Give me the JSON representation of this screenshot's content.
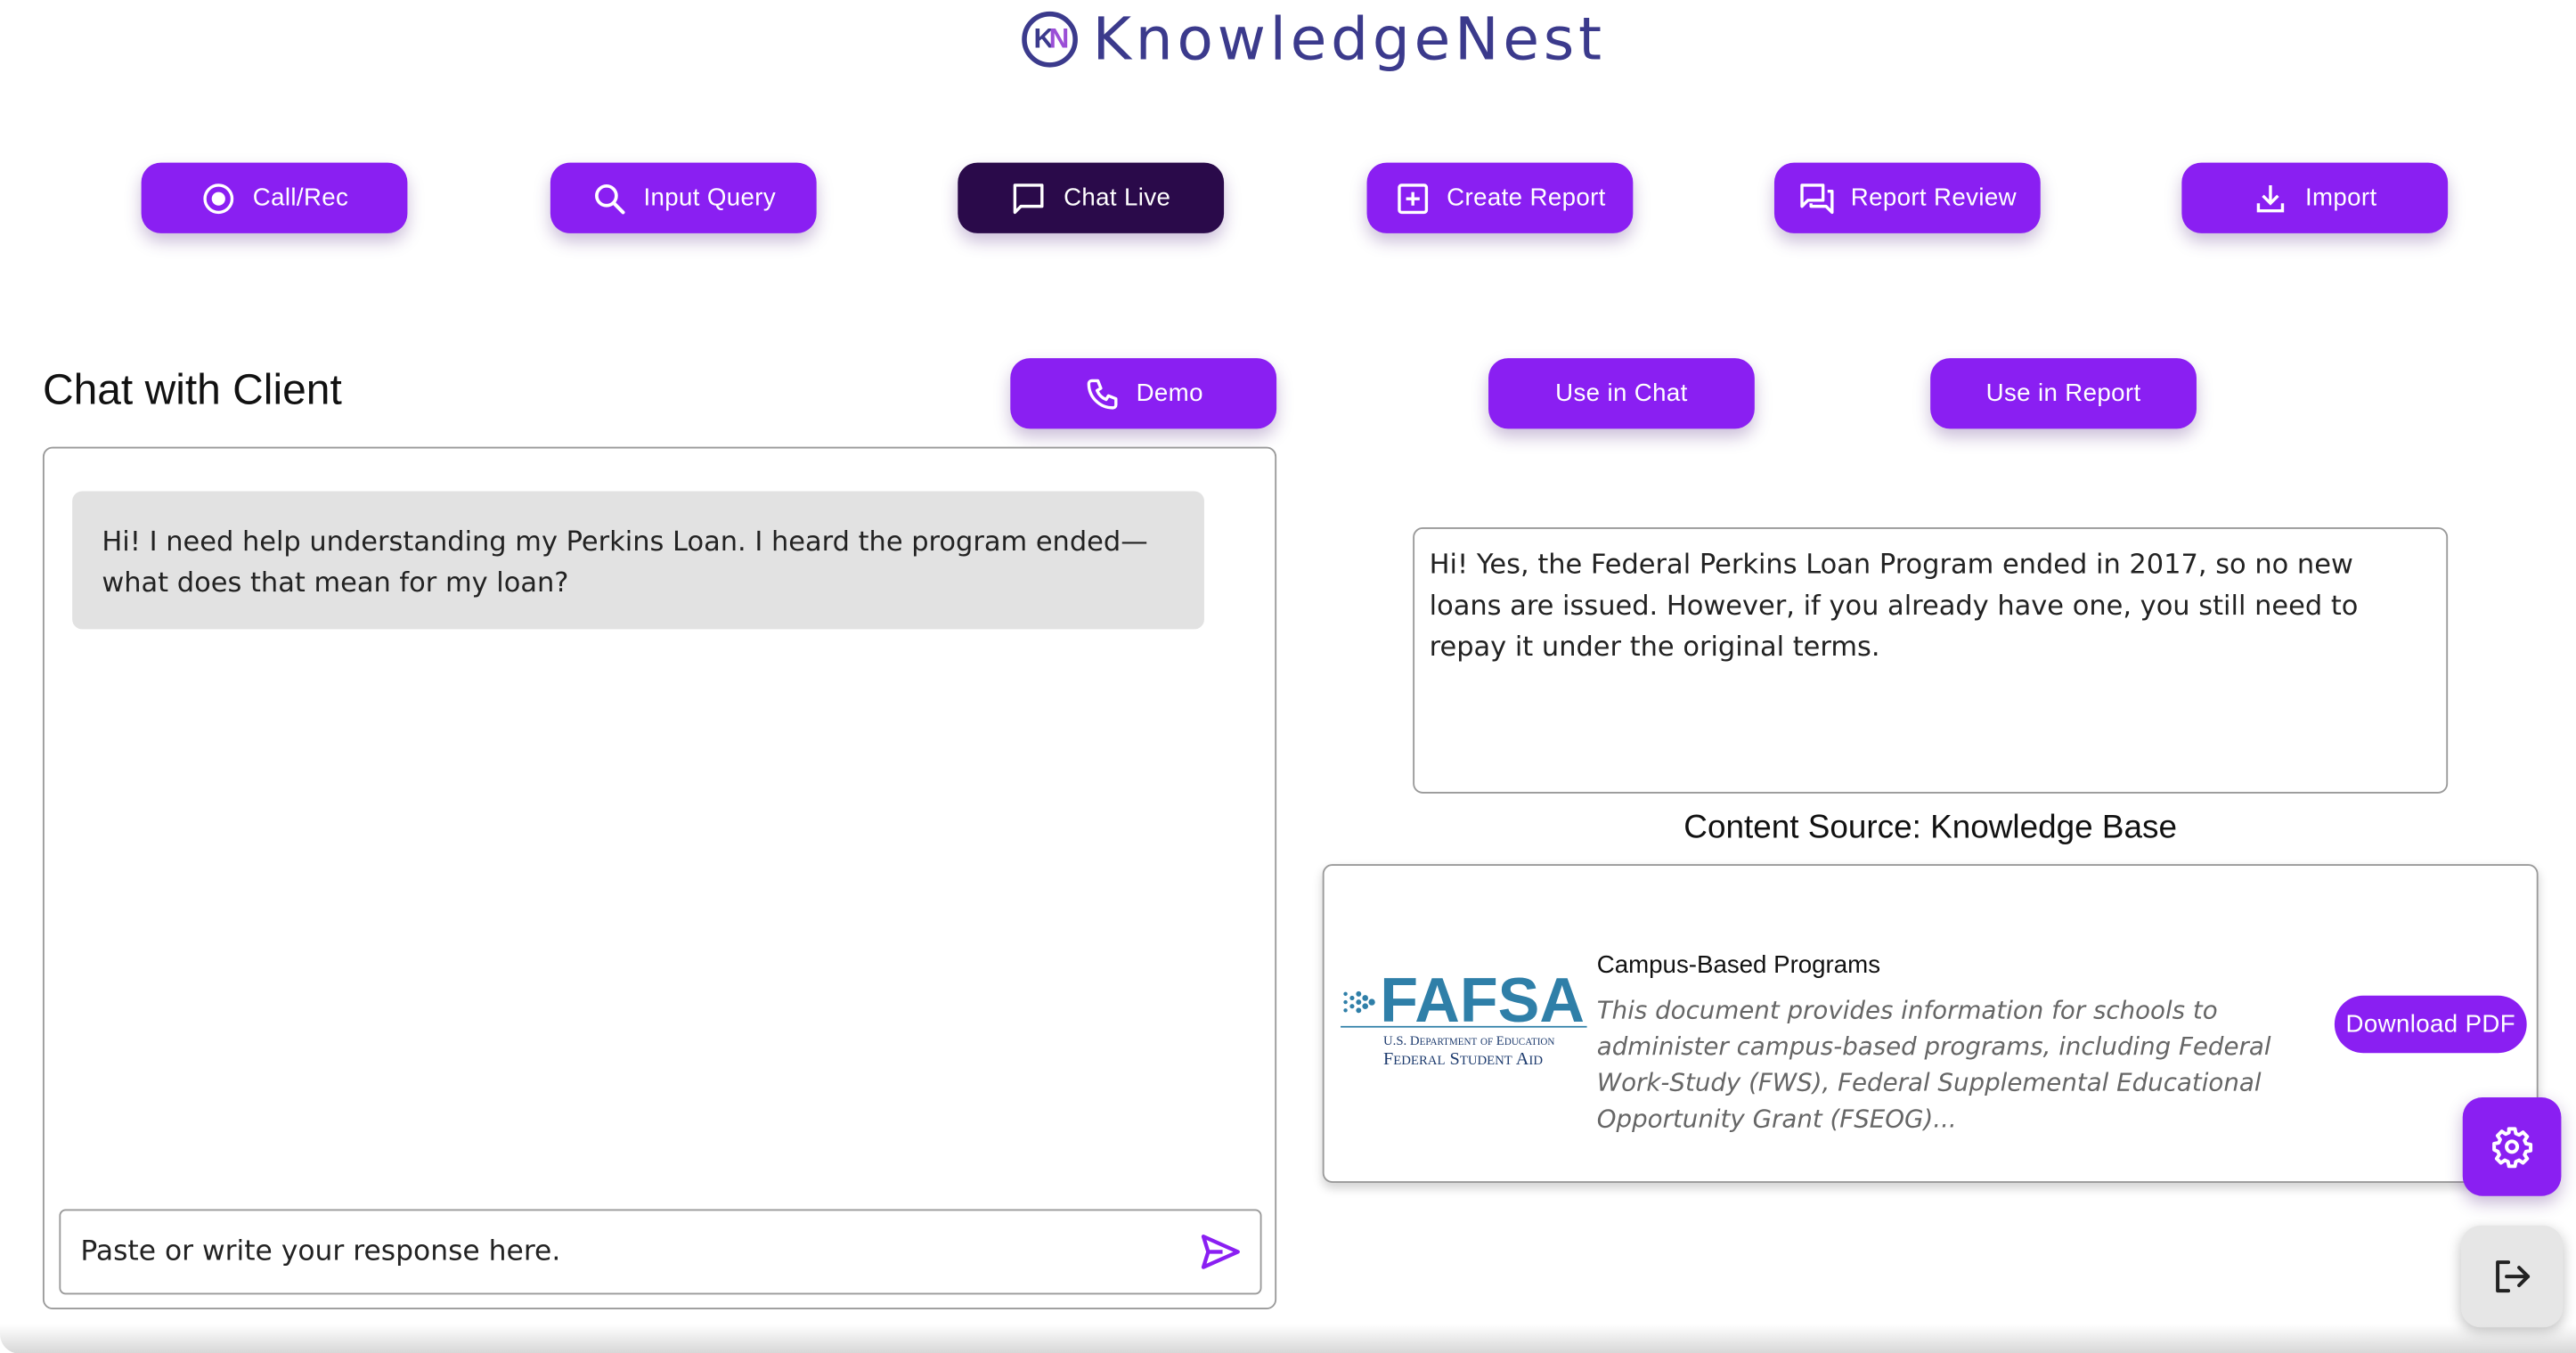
{
  "app": {
    "name": "KnowledgeNest",
    "logo_initials_k": "K",
    "logo_initials_n": "N"
  },
  "nav": {
    "buttons": [
      {
        "label": "Call/Rec",
        "icon": "record-icon",
        "active": false
      },
      {
        "label": "Input Query",
        "icon": "search-icon",
        "active": false
      },
      {
        "label": "Chat Live",
        "icon": "chat-bubble-icon",
        "active": true
      },
      {
        "label": "Create Report",
        "icon": "plus-box-icon",
        "active": false
      },
      {
        "label": "Report Review",
        "icon": "forum-icon",
        "active": false
      },
      {
        "label": "Import",
        "icon": "download-icon",
        "active": false
      }
    ]
  },
  "chat": {
    "title": "Chat with Client",
    "demo_label": "Demo",
    "messages": [
      {
        "from": "client",
        "text": "Hi! I need help understanding my Perkins Loan. I heard the program ended—what does that mean for my loan?"
      }
    ],
    "input_placeholder": "Paste or write your response here."
  },
  "actions": {
    "use_in_chat": "Use in Chat",
    "use_in_report": "Use in Report"
  },
  "response": {
    "text": "Hi! Yes, the Federal Perkins Loan Program ended in 2017, so no new loans are issued. However, if you already have one, you still need to repay it under the original terms."
  },
  "content_source": {
    "heading": "Content Source: Knowledge Base",
    "card": {
      "logo_word": "FAFSA",
      "logo_line1": "U.S. Department of Education",
      "logo_line2": "Federal Student Aid",
      "title": "Campus-Based Programs",
      "description": "This document provides information for schools to administer campus-based programs, including Federal Work-Study (FWS), Federal Supplemental Educational Opportunity Grant (FSEOG)...",
      "download_label": "Download PDF"
    }
  },
  "colors": {
    "accent": "#8a1ff2",
    "active": "#2a0a4a",
    "brand": "#3b3a8c"
  }
}
